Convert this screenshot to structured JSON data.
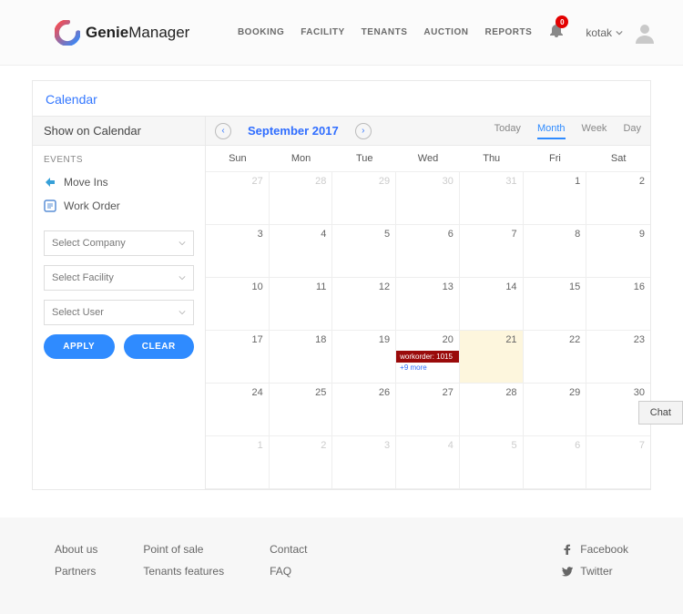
{
  "brand": {
    "name1": "Genie",
    "name2": "Manager"
  },
  "nav": {
    "booking": "BOOKING",
    "facility": "FACILITY",
    "tenants": "TENANTS",
    "auction": "AUCTION",
    "reports": "REPORTS"
  },
  "notif_count": "0",
  "username": "kotak",
  "panel_title": "Calendar",
  "side": {
    "header": "Show on Calendar",
    "events_label": "EVENTS",
    "moveins": "Move Ins",
    "workorder": "Work Order",
    "company": "Select Company",
    "facility": "Select Facility",
    "user": "Select User",
    "apply": "APPLY",
    "clear": "CLEAR"
  },
  "cal": {
    "title": "September 2017",
    "views": {
      "today": "Today",
      "month": "Month",
      "week": "Week",
      "day": "Day"
    },
    "dow": {
      "sun": "Sun",
      "mon": "Mon",
      "tue": "Tue",
      "wed": "Wed",
      "thu": "Thu",
      "fri": "Fri",
      "sat": "Sat"
    },
    "event_label": "workorder: 1015",
    "more_label": "+9 more",
    "cells": {
      "r0": {
        "c0": "27",
        "c1": "28",
        "c2": "29",
        "c3": "30",
        "c4": "31",
        "c5": "1",
        "c6": "2"
      },
      "r1": {
        "c0": "3",
        "c1": "4",
        "c2": "5",
        "c3": "6",
        "c4": "7",
        "c5": "8",
        "c6": "9"
      },
      "r2": {
        "c0": "10",
        "c1": "11",
        "c2": "12",
        "c3": "13",
        "c4": "14",
        "c5": "15",
        "c6": "16"
      },
      "r3": {
        "c0": "17",
        "c1": "18",
        "c2": "19",
        "c3": "20",
        "c4": "21",
        "c5": "22",
        "c6": "23"
      },
      "r4": {
        "c0": "24",
        "c1": "25",
        "c2": "26",
        "c3": "27",
        "c4": "28",
        "c5": "29",
        "c6": "30"
      },
      "r5": {
        "c0": "1",
        "c1": "2",
        "c2": "3",
        "c3": "4",
        "c4": "5",
        "c5": "6",
        "c6": "7"
      }
    }
  },
  "chat": "Chat",
  "footer": {
    "about": "About us",
    "partners": "Partners",
    "pos": "Point of sale",
    "tenfeat": "Tenants features",
    "contact": "Contact",
    "faq": "FAQ",
    "fb": "Facebook",
    "tw": "Twitter"
  }
}
